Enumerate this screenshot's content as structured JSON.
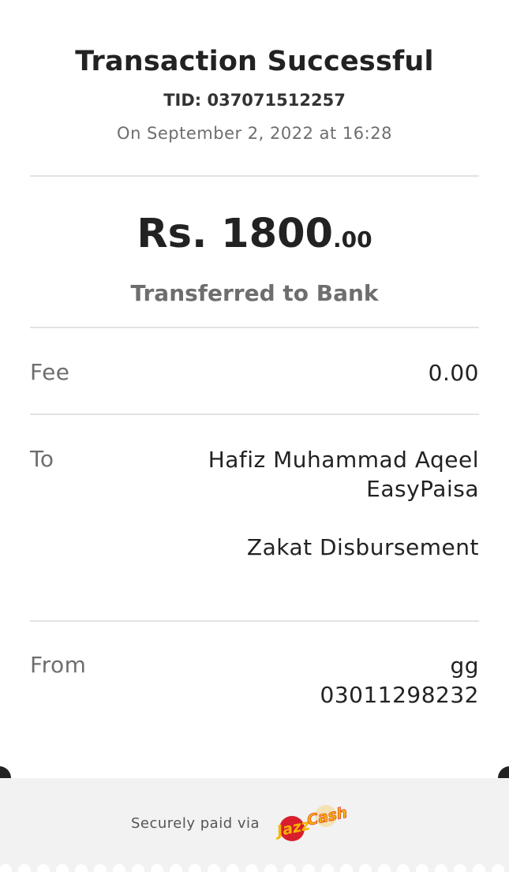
{
  "header": {
    "title": "Transaction Successful",
    "tid": "TID: 037071512257",
    "date": "On September 2, 2022 at 16:28"
  },
  "amount": {
    "main": "Rs. 1800",
    "decimals": ".00",
    "caption": "Transferred to Bank"
  },
  "fee": {
    "label": "Fee",
    "value": "0.00"
  },
  "to": {
    "label": "To",
    "name": "Hafiz Muhammad Aqeel",
    "bank": "EasyPaisa",
    "purpose": "Zakat Disbursement"
  },
  "from": {
    "label": "From",
    "name": "gg",
    "number": "03011298232"
  },
  "footer": {
    "secure_text": "Securely paid via",
    "logo_jazz": "Jazz",
    "logo_cash": "Cash"
  },
  "colors": {
    "logo_yellow": "#f7b500",
    "logo_red": "#d81e2c",
    "notch": "#222222",
    "footer_bg": "#f2f2f2"
  }
}
